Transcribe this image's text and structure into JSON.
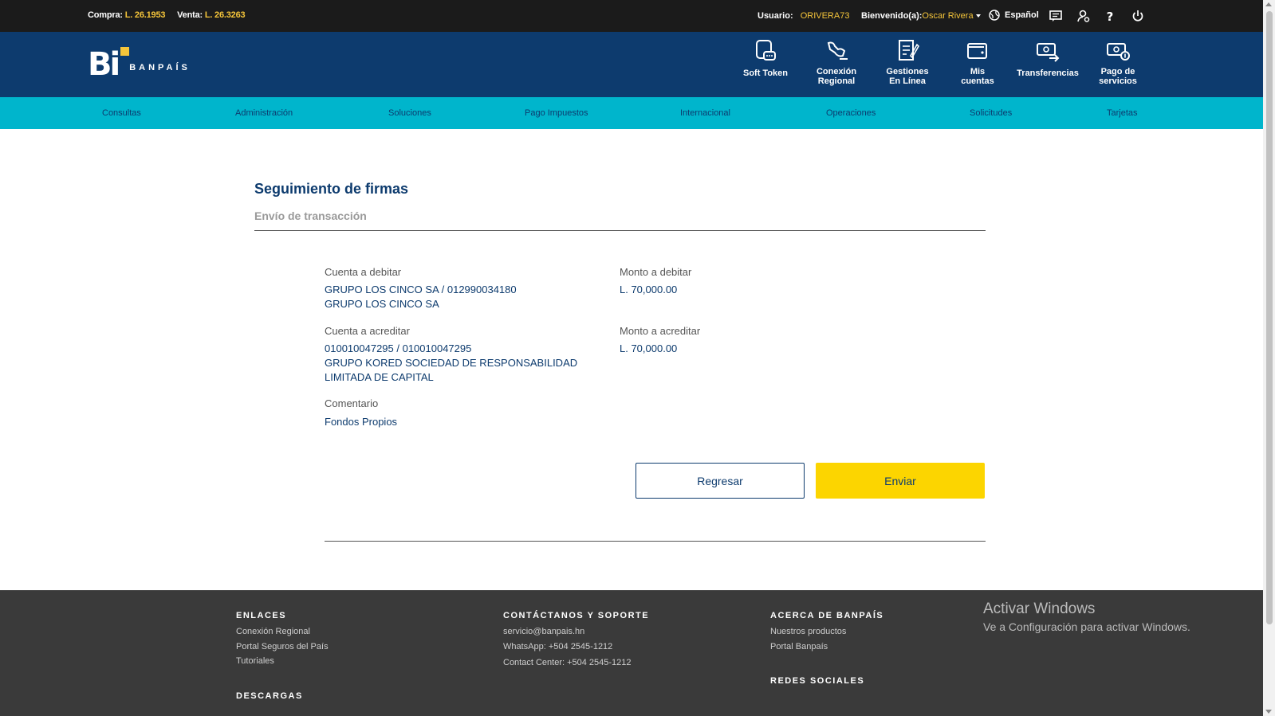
{
  "topbar": {
    "buy_label": "Compra:",
    "buy_value": "L. 26.1953",
    "sell_label": "Venta:",
    "sell_value": "L. 26.3263",
    "user_label": "Usuario:",
    "user_value": "ORIVERA73",
    "welcome_label": "Bienvenido(a):",
    "welcome_name": "Oscar Rivera",
    "language": "Español"
  },
  "header": {
    "logo_letters": "Bi",
    "brand": "BANPAÍS",
    "quick_links": [
      {
        "line1": "Soft Token",
        "line2": "",
        "icon": "soft-token-icon"
      },
      {
        "line1": "Conexión",
        "line2": "Regional",
        "icon": "regional-connection-icon"
      },
      {
        "line1": "Gestiones",
        "line2": "En Línea",
        "icon": "online-document-icon"
      },
      {
        "line1": "Mis",
        "line2": "cuentas",
        "icon": "wallet-icon"
      },
      {
        "line1": "Transferencias",
        "line2": "",
        "icon": "money-transfer-icon"
      },
      {
        "line1": "Pago de",
        "line2": "servicios",
        "icon": "service-payment-icon"
      }
    ]
  },
  "nav": {
    "items": [
      "Consultas",
      "Administración",
      "Soluciones",
      "Pago Impuestos",
      "Internacional",
      "Operaciones",
      "Solicitudes",
      "Tarjetas"
    ]
  },
  "main": {
    "title": "Seguimiento de firmas",
    "subtitle": "Envío de transacción",
    "debit_account_label": "Cuenta a debitar",
    "debit_account_line1": "GRUPO LOS CINCO SA / 012990034180",
    "debit_account_line2": "GRUPO LOS CINCO SA",
    "debit_amount_label": "Monto a debitar",
    "debit_amount": "L. 70,000.00",
    "credit_account_label": "Cuenta a acreditar",
    "credit_account_line1": "010010047295 / 010010047295",
    "credit_account_line2": "GRUPO KORED SOCIEDAD DE RESPONSABILIDAD",
    "credit_account_line3": "LIMITADA DE CAPITAL",
    "credit_amount_label": "Monto a acreditar",
    "credit_amount": "L. 70,000.00",
    "comment_label": "Comentario",
    "comment_value": "Fondos Propios",
    "back_button": "Regresar",
    "send_button": "Enviar"
  },
  "footer": {
    "links_heading": "ENLACES",
    "links": [
      "Conexión Regional",
      "Portal Seguros del País",
      "Tutoriales"
    ],
    "downloads_heading": "DESCARGAS",
    "contact_heading": "CONTÁCTANOS Y SOPORTE",
    "contact": [
      "servicio@banpais.hn",
      "WhatsApp: +504 2545-1212",
      "Contact Center: +504 2545-1212"
    ],
    "about_heading": "ACERCA DE BANPAÍS",
    "about": [
      "Nuestros productos",
      "Portal Banpaís"
    ],
    "social_heading": "REDES SOCIALES",
    "watermark_title": "Activar Windows",
    "watermark_sub": "Ve a Configuración para activar Windows."
  },
  "colors": {
    "top_bar": "#1b1b1b",
    "header": "#0d3b6e",
    "nav": "#00b5cc",
    "accent_yellow": "#fcd500",
    "footer": "#3a3a3a"
  }
}
